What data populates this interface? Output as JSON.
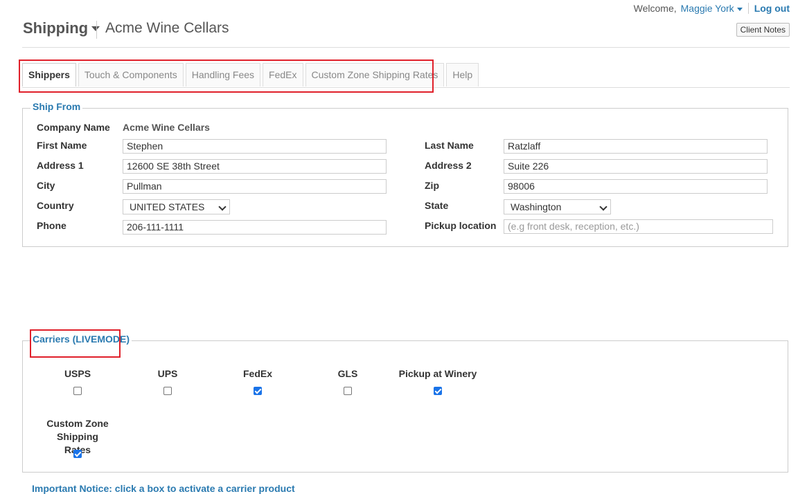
{
  "user_bar": {
    "welcome_label": "Welcome,",
    "user_name": "Maggie York",
    "logout_label": "Log out",
    "client_notes_label": "Client Notes"
  },
  "header": {
    "section_title": "Shipping",
    "org_name": "Acme Wine Cellars"
  },
  "tabs": [
    {
      "label": "Shippers",
      "active": true
    },
    {
      "label": "Touch & Components",
      "active": false
    },
    {
      "label": "Handling Fees",
      "active": false
    },
    {
      "label": "FedEx",
      "active": false
    },
    {
      "label": "Custom Zone Shipping Rates",
      "active": false
    },
    {
      "label": "Help",
      "active": false
    }
  ],
  "ship_from": {
    "legend": "Ship From",
    "company_name_label": "Company Name",
    "company_name_value": "Acme Wine Cellars",
    "first_name_label": "First Name",
    "first_name_value": "Stephen",
    "last_name_label": "Last Name",
    "last_name_value": "Ratzlaff",
    "address1_label": "Address 1",
    "address1_value": "12600 SE 38th Street",
    "address2_label": "Address 2",
    "address2_value": "Suite 226",
    "city_label": "City",
    "city_value": "Pullman",
    "zip_label": "Zip",
    "zip_value": "98006",
    "country_label": "Country",
    "country_value": "UNITED STATES",
    "state_label": "State",
    "state_value": "Washington",
    "phone_label": "Phone",
    "phone_value": "206-111-1111",
    "pickup_label": "Pickup location",
    "pickup_placeholder": "(e.g front desk, reception, etc.)"
  },
  "carriers": {
    "legend": "Carriers (LIVEMODE)",
    "items": [
      {
        "name": "USPS",
        "checked": false
      },
      {
        "name": "UPS",
        "checked": false
      },
      {
        "name": "FedEx",
        "checked": true
      },
      {
        "name": "GLS",
        "checked": false
      },
      {
        "name": "Pickup at Winery",
        "checked": true
      },
      {
        "name": "Custom Zone Shipping Rates",
        "checked": true
      }
    ]
  },
  "notice": {
    "text": "Important Notice: click a box to activate a carrier product"
  },
  "colors": {
    "link": "#2a7ab0",
    "highlight_box": "#e0202a",
    "checkbox_on": "#1a73e8"
  }
}
